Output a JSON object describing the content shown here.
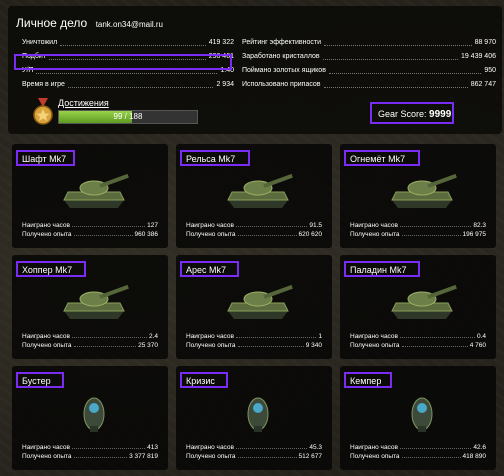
{
  "profile": {
    "title": "Личное дело",
    "email": "tank.on34@mail.ru",
    "left_stats": [
      {
        "label": "Уничтожил",
        "value": "419 322"
      },
      {
        "label": "Подбит",
        "value": "298 461"
      },
      {
        "label": "У/П",
        "value": "1.40"
      },
      {
        "label": "Время в игре",
        "value": "2 934"
      }
    ],
    "right_stats": [
      {
        "label": "Рейтинг эффективности",
        "value": "88 970"
      },
      {
        "label": "Заработано кристаллов",
        "value": "19 439 406"
      },
      {
        "label": "Поймано золотых ящиков",
        "value": "950"
      },
      {
        "label": "Использовано припасов",
        "value": "862 747"
      }
    ],
    "achievements_label": "Достижения",
    "achievements_progress": "99 / 188",
    "achievements_fraction": 0.527,
    "gear_score_label": "Gear Score:",
    "gear_score_value": "9999"
  },
  "hours_label": "Наиграно часов",
  "exp_label": "Получено опыта",
  "cards": [
    {
      "name": "Шафт Mk7",
      "hours": "127",
      "exp": "960 386"
    },
    {
      "name": "Рельса Mk7",
      "hours": "91.5",
      "exp": "620 620"
    },
    {
      "name": "Огнемёт Mk7",
      "hours": "82.3",
      "exp": "196 975"
    },
    {
      "name": "Хоппер Mk7",
      "hours": "2.4",
      "exp": "25 370"
    },
    {
      "name": "Арес Mk7",
      "hours": "1",
      "exp": "9 340"
    },
    {
      "name": "Паладин Mk7",
      "hours": "0.4",
      "exp": "4 760"
    },
    {
      "name": "Бустер",
      "hours": "413",
      "exp": "3 377 819"
    },
    {
      "name": "Кризис",
      "hours": "45.3",
      "exp": "512 677"
    },
    {
      "name": "Кемпер",
      "hours": "42.6",
      "exp": "418 890"
    }
  ]
}
